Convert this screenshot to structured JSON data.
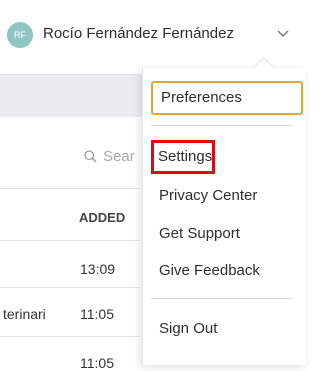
{
  "header": {
    "avatar_initials": "RF",
    "user_name": "Rocío Fernández Fernández",
    "chevron_icon": "chevron-down-icon"
  },
  "background_page": {
    "search_placeholder": "Sear",
    "column_header": "ADDED",
    "rows": [
      {
        "name": "",
        "time": "13:09"
      },
      {
        "name": "terinari",
        "time": "11:05"
      },
      {
        "name": "",
        "time": "11:05"
      }
    ]
  },
  "user_menu": {
    "items": [
      {
        "label": "Preferences"
      },
      {
        "label": "Settings"
      },
      {
        "label": "Privacy Center"
      },
      {
        "label": "Get Support"
      },
      {
        "label": "Give Feedback"
      },
      {
        "label": "Sign Out"
      }
    ]
  },
  "colors": {
    "avatar": "#8dc6c2",
    "focus_outline": "#e7a338",
    "highlight_box": "#e30613"
  }
}
